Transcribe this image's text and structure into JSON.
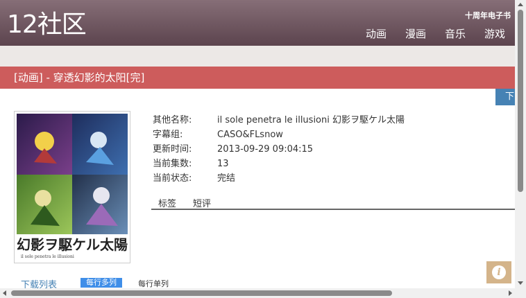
{
  "site": {
    "logo": "12社区",
    "promo": "十周年电子书",
    "nav": [
      "动画",
      "漫画",
      "音乐",
      "游戏"
    ]
  },
  "page": {
    "title": "[动画] - 穿透幻影的太阳[完]",
    "download_tab": "下"
  },
  "cover": {
    "title_jp": "幻影ヲ駆ケル太陽",
    "subtitle": "il sole penetra le illusioni",
    "accent_color": "#f2d04a"
  },
  "info": [
    {
      "key": "其他名称:",
      "value": "il sole penetra le illusioni 幻影ヲ駆ケル太陽"
    },
    {
      "key": "字幕组:",
      "value": "CASO&FLsnow"
    },
    {
      "key": "更新时间:",
      "value": "2013-09-29 09:04:15"
    },
    {
      "key": "当前集数:",
      "value": "13"
    },
    {
      "key": "当前状态:",
      "value": "完结"
    }
  ],
  "subtabs": [
    "标签",
    "短评"
  ],
  "downloads": {
    "label": "下载列表",
    "view_multi": "每行多列",
    "view_single": "每行单列"
  },
  "colors": {
    "header": "#6f5761",
    "title_bar": "#cd5c5c",
    "accent_blue": "#4682b4"
  }
}
